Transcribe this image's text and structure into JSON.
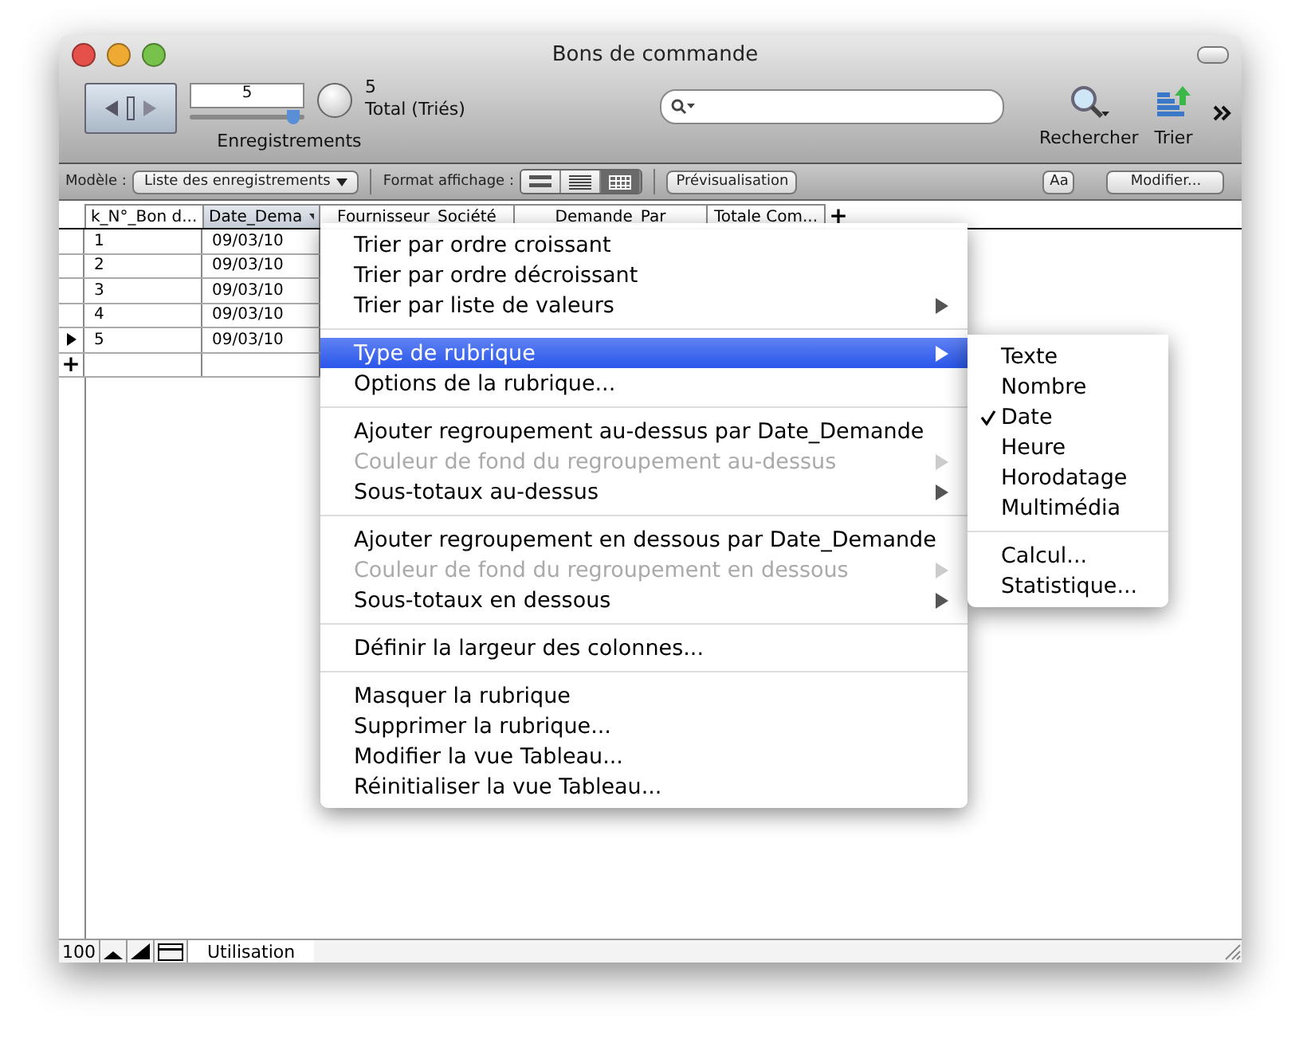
{
  "window": {
    "title": "Bons de commande"
  },
  "toolbar": {
    "record": "5",
    "record_slider": {
      "level": 0.9
    },
    "found": "5",
    "total": "Total (Triés)",
    "records_label": "Enregistrements",
    "buttons": [
      {
        "label": "Rechercher",
        "kind": "search"
      },
      {
        "label": "Trier",
        "kind": "sort"
      }
    ]
  },
  "layout_bar": {
    "layout_label": "Modèle :",
    "layout": "Liste des enregistrements",
    "format_label": "Format affichage :",
    "views": [
      {
        "kind": "form",
        "selected": false
      },
      {
        "kind": "list",
        "selected": false
      },
      {
        "kind": "table",
        "selected": true
      }
    ],
    "preview": "Prévisualisation",
    "font_button": "Aa",
    "modify": "Modifier..."
  },
  "table": {
    "columns": [
      {
        "label": "k_N°_Bon d...",
        "selected": false
      },
      {
        "label": "Date_Dema",
        "selected": true
      },
      {
        "label": "Fournisseur_Société",
        "selected": false
      },
      {
        "label": "Demande_Par",
        "selected": false
      },
      {
        "label": "Totale Com...",
        "selected": false
      }
    ],
    "add_column": "+",
    "rows": [
      {
        "cells": [
          "1",
          "09/03/10"
        ],
        "current": false
      },
      {
        "cells": [
          "2",
          "09/03/10"
        ],
        "current": false
      },
      {
        "cells": [
          "3",
          "09/03/10"
        ],
        "current": false
      },
      {
        "cells": [
          "4",
          "09/03/10"
        ],
        "current": false
      },
      {
        "cells": [
          "5",
          "09/03/10"
        ],
        "current": true
      }
    ],
    "add_row": "+"
  },
  "context_menu": {
    "sections": [
      [
        {
          "label": "Trier par ordre croissant",
          "disabled": false,
          "submenu": false,
          "highlighted": false
        },
        {
          "label": "Trier par ordre décroissant",
          "disabled": false,
          "submenu": false,
          "highlighted": false
        },
        {
          "label": "Trier par liste de valeurs",
          "disabled": false,
          "submenu": true,
          "highlighted": false
        }
      ],
      [
        {
          "label": "Type de rubrique",
          "disabled": false,
          "submenu": true,
          "highlighted": true
        },
        {
          "label": "Options de la rubrique...",
          "disabled": false,
          "submenu": false,
          "highlighted": false
        }
      ],
      [
        {
          "label": "Ajouter regroupement au-dessus par Date_Demande",
          "disabled": false,
          "submenu": false,
          "highlighted": false
        },
        {
          "label": "Couleur de fond du regroupement au-dessus",
          "disabled": true,
          "submenu": true,
          "highlighted": false
        },
        {
          "label": "Sous-totaux au-dessus",
          "disabled": false,
          "submenu": true,
          "highlighted": false
        }
      ],
      [
        {
          "label": "Ajouter regroupement en dessous par Date_Demande",
          "disabled": false,
          "submenu": false,
          "highlighted": false
        },
        {
          "label": "Couleur de fond du regroupement en dessous",
          "disabled": true,
          "submenu": true,
          "highlighted": false
        },
        {
          "label": "Sous-totaux en dessous",
          "disabled": false,
          "submenu": true,
          "highlighted": false
        }
      ],
      [
        {
          "label": "Définir la largeur des colonnes...",
          "disabled": false,
          "submenu": false,
          "highlighted": false
        }
      ],
      [
        {
          "label": "Masquer la rubrique",
          "disabled": false,
          "submenu": false,
          "highlighted": false
        },
        {
          "label": "Supprimer la rubrique...",
          "disabled": false,
          "submenu": false,
          "highlighted": false
        },
        {
          "label": "Modifier la vue Tableau...",
          "disabled": false,
          "submenu": false,
          "highlighted": false
        },
        {
          "label": "Réinitialiser la vue Tableau...",
          "disabled": false,
          "submenu": false,
          "highlighted": false
        }
      ]
    ]
  },
  "submenu": {
    "sections": [
      [
        {
          "label": "Texte",
          "checked": false
        },
        {
          "label": "Nombre",
          "checked": false
        },
        {
          "label": "Date",
          "checked": true
        },
        {
          "label": "Heure",
          "checked": false
        },
        {
          "label": "Horodatage",
          "checked": false
        },
        {
          "label": "Multimédia",
          "checked": false
        }
      ],
      [
        {
          "label": "Calcul...",
          "checked": false
        },
        {
          "label": "Statistique...",
          "checked": false
        }
      ]
    ]
  },
  "status_bar": {
    "zoom": "100",
    "mode": "Utilisation"
  }
}
